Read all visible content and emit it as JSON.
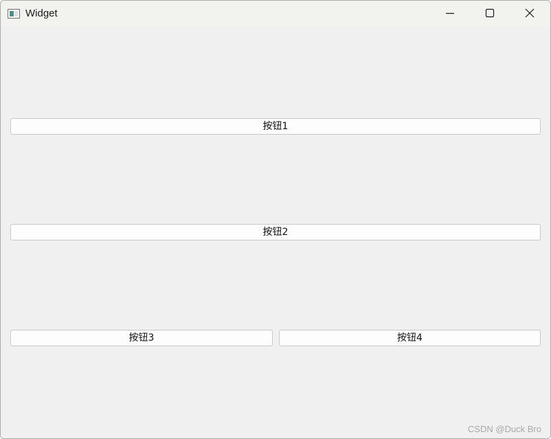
{
  "window": {
    "title": "Widget",
    "app_icon": "window-icon",
    "caption_buttons": [
      "minimize-icon",
      "maximize-icon",
      "close-icon"
    ]
  },
  "buttons": {
    "btn1": "按钮1",
    "btn2": "按钮2",
    "btn3": "按钮3",
    "btn4": "按钮4"
  },
  "watermark": "CSDN @Duck Bro",
  "colors": {
    "titlebar": "#f2f2ef",
    "client_bg": "#f0f0f0",
    "button_bg": "#fdfdfd",
    "button_border": "#c8c8c8",
    "app_icon_accent": "#4b8f86"
  }
}
